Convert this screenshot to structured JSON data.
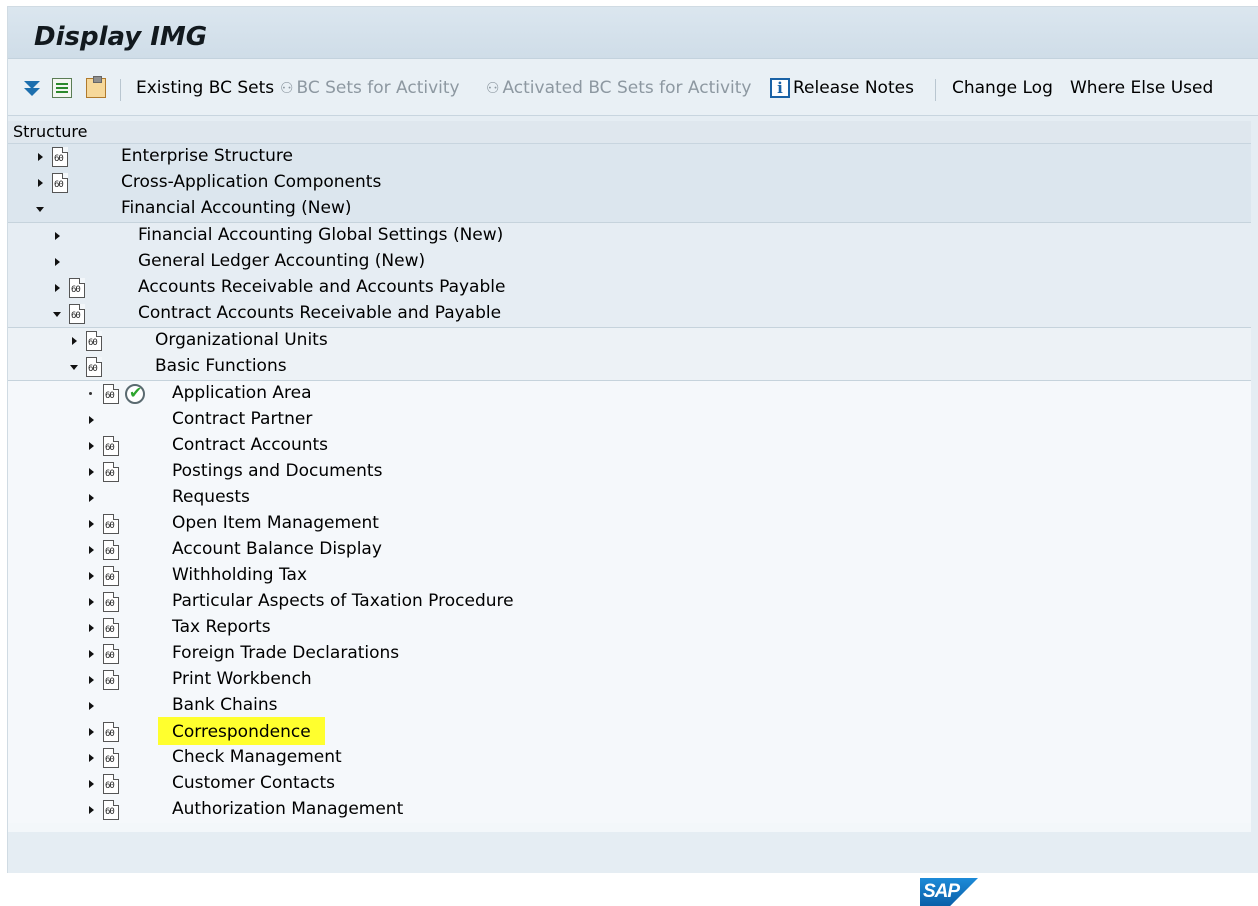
{
  "header": {
    "title": "Display IMG"
  },
  "toolbar": {
    "existing_bc_sets": "Existing BC Sets",
    "bc_sets_for_activity": "BC Sets for Activity",
    "activated_bc_sets": "Activated BC Sets for Activity",
    "release_notes": "Release Notes",
    "change_log": "Change Log",
    "where_else_used": "Where Else Used"
  },
  "structure": {
    "header": "Structure",
    "rows": [
      {
        "label": "Enterprise Structure",
        "level": 0,
        "state": "collapsed",
        "doc": true,
        "activity": false
      },
      {
        "label": "Cross-Application Components",
        "level": 0,
        "state": "collapsed",
        "doc": true,
        "activity": false
      },
      {
        "label": "Financial Accounting (New)",
        "level": 0,
        "state": "expanded",
        "doc": false,
        "activity": false
      },
      {
        "label": "Financial Accounting Global Settings (New)",
        "level": 1,
        "state": "collapsed",
        "doc": false,
        "activity": false
      },
      {
        "label": "General Ledger Accounting (New)",
        "level": 1,
        "state": "collapsed",
        "doc": false,
        "activity": false
      },
      {
        "label": "Accounts Receivable and Accounts Payable",
        "level": 1,
        "state": "collapsed",
        "doc": true,
        "activity": false
      },
      {
        "label": "Contract Accounts Receivable and Payable",
        "level": 1,
        "state": "expanded",
        "doc": true,
        "activity": false
      },
      {
        "label": "Organizational Units",
        "level": 2,
        "state": "collapsed",
        "doc": true,
        "activity": false
      },
      {
        "label": "Basic Functions",
        "level": 2,
        "state": "expanded",
        "doc": true,
        "activity": false
      },
      {
        "label": "Application Area",
        "level": 3,
        "state": "leaf",
        "doc": true,
        "activity": true
      },
      {
        "label": "Contract Partner",
        "level": 3,
        "state": "collapsed",
        "doc": false,
        "activity": false
      },
      {
        "label": "Contract Accounts",
        "level": 3,
        "state": "collapsed",
        "doc": true,
        "activity": false
      },
      {
        "label": "Postings and Documents",
        "level": 3,
        "state": "collapsed",
        "doc": true,
        "activity": false
      },
      {
        "label": "Requests",
        "level": 3,
        "state": "collapsed",
        "doc": false,
        "activity": false
      },
      {
        "label": "Open Item Management",
        "level": 3,
        "state": "collapsed",
        "doc": true,
        "activity": false
      },
      {
        "label": "Account Balance Display",
        "level": 3,
        "state": "collapsed",
        "doc": true,
        "activity": false
      },
      {
        "label": "Withholding Tax",
        "level": 3,
        "state": "collapsed",
        "doc": true,
        "activity": false
      },
      {
        "label": "Particular Aspects of Taxation Procedure",
        "level": 3,
        "state": "collapsed",
        "doc": true,
        "activity": false
      },
      {
        "label": "Tax Reports",
        "level": 3,
        "state": "collapsed",
        "doc": true,
        "activity": false
      },
      {
        "label": "Foreign Trade Declarations",
        "level": 3,
        "state": "collapsed",
        "doc": true,
        "activity": false
      },
      {
        "label": "Print Workbench",
        "level": 3,
        "state": "collapsed",
        "doc": true,
        "activity": false
      },
      {
        "label": "Bank Chains",
        "level": 3,
        "state": "collapsed",
        "doc": false,
        "activity": false
      },
      {
        "label": "Correspondence",
        "level": 3,
        "state": "collapsed",
        "doc": true,
        "activity": false,
        "highlight": true
      },
      {
        "label": "Check Management",
        "level": 3,
        "state": "collapsed",
        "doc": true,
        "activity": false
      },
      {
        "label": "Customer Contacts",
        "level": 3,
        "state": "collapsed",
        "doc": true,
        "activity": false
      },
      {
        "label": "Authorization Management",
        "level": 3,
        "state": "collapsed",
        "doc": true,
        "activity": false
      }
    ]
  },
  "colors": {
    "highlight": "#ffff2e",
    "accent": "#1d6fae"
  }
}
